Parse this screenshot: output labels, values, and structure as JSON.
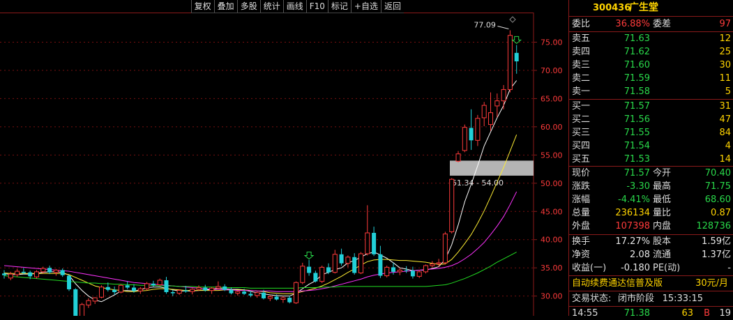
{
  "toolbar": [
    "复权",
    "叠加",
    "多股",
    "统计",
    "画线",
    "F10",
    "标记",
    "+自选",
    "返回"
  ],
  "stock": {
    "code": "300436",
    "name": "广生堂"
  },
  "chart": {
    "y_ticks": [
      "75.00",
      "70.00",
      "65.00",
      "60.00",
      "55.00",
      "50.00",
      "45.00",
      "40.00",
      "35.00",
      "30.00"
    ],
    "high_label": "77.09",
    "zone_label": "51.34 - 54.00",
    "zone_low": 51.34,
    "zone_high": 54.0,
    "ymin": 26.5,
    "ymax": 80.0,
    "candles": [
      [
        34.0,
        34.6,
        33.1,
        33.7
      ],
      [
        33.2,
        34.3,
        32.8,
        33.9
      ],
      [
        33.8,
        34.8,
        33.4,
        34.4
      ],
      [
        34.3,
        35.0,
        33.9,
        34.1
      ],
      [
        34.2,
        34.5,
        33.0,
        33.5
      ],
      [
        33.4,
        34.6,
        33.1,
        34.3
      ],
      [
        34.3,
        35.2,
        34.0,
        34.9
      ],
      [
        35.0,
        35.4,
        33.9,
        34.2
      ],
      [
        34.2,
        34.8,
        33.6,
        34.6
      ],
      [
        34.6,
        34.9,
        33.4,
        33.7
      ],
      [
        33.6,
        33.8,
        30.9,
        31.2
      ],
      [
        31.2,
        31.4,
        25.5,
        26.3
      ],
      [
        26.3,
        28.8,
        26.1,
        28.5
      ],
      [
        28.4,
        29.6,
        27.9,
        29.2
      ],
      [
        29.1,
        29.8,
        28.6,
        29.7
      ],
      [
        29.8,
        31.9,
        29.6,
        31.6
      ],
      [
        31.6,
        32.4,
        30.8,
        31.1
      ],
      [
        31.1,
        31.7,
        30.2,
        30.7
      ],
      [
        30.7,
        32.1,
        30.5,
        31.9
      ],
      [
        31.9,
        32.6,
        31.2,
        31.5
      ],
      [
        31.5,
        32.1,
        30.6,
        30.9
      ],
      [
        30.9,
        31.6,
        30.4,
        31.3
      ],
      [
        31.3,
        32.5,
        31.0,
        32.2
      ],
      [
        32.2,
        32.7,
        31.6,
        31.9
      ],
      [
        32.0,
        33.1,
        31.8,
        32.8
      ],
      [
        32.8,
        33.4,
        30.4,
        30.7
      ],
      [
        30.7,
        31.1,
        30.0,
        30.5
      ],
      [
        30.5,
        31.2,
        30.2,
        31.0
      ],
      [
        31.0,
        31.8,
        30.6,
        30.8
      ],
      [
        30.8,
        31.4,
        30.3,
        31.2
      ],
      [
        31.2,
        31.9,
        30.9,
        31.5
      ],
      [
        31.5,
        32.0,
        30.8,
        31.0
      ],
      [
        31.0,
        31.6,
        30.4,
        31.4
      ],
      [
        31.4,
        32.6,
        31.2,
        31.7
      ],
      [
        31.7,
        32.1,
        30.9,
        31.1
      ],
      [
        31.1,
        31.5,
        30.3,
        30.5
      ],
      [
        30.5,
        31.0,
        30.1,
        30.8
      ],
      [
        30.8,
        31.3,
        30.2,
        30.4
      ],
      [
        30.4,
        30.9,
        29.8,
        30.1
      ],
      [
        30.1,
        30.8,
        29.7,
        30.6
      ],
      [
        30.6,
        31.1,
        29.4,
        29.6
      ],
      [
        29.6,
        30.2,
        29.1,
        29.9
      ],
      [
        29.9,
        30.3,
        29.2,
        29.4
      ],
      [
        29.4,
        30.0,
        28.8,
        29.7
      ],
      [
        29.7,
        30.1,
        28.7,
        28.9
      ],
      [
        28.8,
        32.6,
        28.6,
        32.4
      ],
      [
        32.4,
        35.9,
        32.1,
        35.3
      ],
      [
        35.2,
        36.4,
        33.6,
        34.1
      ],
      [
        34.1,
        34.5,
        32.4,
        32.6
      ],
      [
        32.6,
        35.4,
        32.3,
        35.1
      ],
      [
        35.1,
        35.8,
        33.9,
        34.2
      ],
      [
        34.2,
        38.2,
        34.0,
        37.4
      ],
      [
        37.4,
        38.4,
        35.4,
        35.8
      ],
      [
        35.8,
        37.2,
        35.1,
        36.9
      ],
      [
        36.9,
        37.6,
        33.8,
        34.1
      ],
      [
        34.1,
        37.8,
        33.9,
        37.5
      ],
      [
        37.5,
        46.1,
        37.2,
        41.2
      ],
      [
        41.2,
        42.3,
        37.1,
        37.4
      ],
      [
        37.4,
        38.9,
        33.2,
        33.6
      ],
      [
        33.6,
        35.4,
        33.3,
        35.1
      ],
      [
        35.1,
        35.9,
        33.8,
        34.3
      ],
      [
        34.3,
        35.0,
        33.7,
        34.6
      ],
      [
        34.6,
        35.3,
        34.1,
        34.5
      ],
      [
        34.5,
        35.2,
        33.1,
        33.5
      ],
      [
        33.5,
        34.6,
        33.2,
        34.3
      ],
      [
        34.3,
        35.6,
        34.0,
        35.4
      ],
      [
        35.4,
        36.2,
        35.1,
        35.7
      ],
      [
        35.7,
        36.6,
        35.2,
        35.9
      ],
      [
        35.9,
        41.4,
        35.6,
        41.0
      ],
      [
        41.4,
        50.9,
        41.1,
        50.7
      ],
      [
        53.9,
        55.7,
        53.7,
        55.2
      ],
      [
        55.8,
        60.4,
        55.5,
        59.9
      ],
      [
        59.8,
        63.1,
        55.9,
        57.6
      ],
      [
        57.6,
        62.1,
        56.6,
        61.5
      ],
      [
        61.6,
        64.4,
        60.1,
        63.8
      ],
      [
        60.4,
        66.1,
        59.3,
        62.5
      ],
      [
        63.7,
        65.9,
        61.7,
        64.6
      ],
      [
        64.6,
        67.4,
        63.1,
        66.6
      ],
      [
        66.6,
        77.1,
        66.1,
        76.2
      ],
      [
        73.1,
        74.5,
        69.4,
        71.6
      ]
    ],
    "ma": [
      {
        "color": "#ffffff",
        "values": [
          34.0,
          33.8,
          33.8,
          33.9,
          33.9,
          34.0,
          34.2,
          34.3,
          34.3,
          34.2,
          33.7,
          32.2,
          31.0,
          30.0,
          29.3,
          29.0,
          29.6,
          30.2,
          30.9,
          31.0,
          30.9,
          31.1,
          31.5,
          31.6,
          31.6,
          31.4,
          31.1,
          30.9,
          30.9,
          30.9,
          31.0,
          31.1,
          31.2,
          31.4,
          31.3,
          31.2,
          31.2,
          31.1,
          30.8,
          30.6,
          30.4,
          30.2,
          30.1,
          30.0,
          30.0,
          30.5,
          31.3,
          32.1,
          32.7,
          33.8,
          34.2,
          34.7,
          35.0,
          35.9,
          36.3,
          36.9,
          37.5,
          37.8,
          37.3,
          36.7,
          35.9,
          35.0,
          34.8,
          34.5,
          34.6,
          34.6,
          34.9,
          35.2,
          36.5,
          39.1,
          42.6,
          46.7,
          49.8,
          53.1,
          56.6,
          59.1,
          61.6,
          63.8,
          66.7,
          68.2
        ]
      },
      {
        "color": "#ffee33",
        "values": [
          34.1,
          34.0,
          34.0,
          34.0,
          34.0,
          34.0,
          34.0,
          34.0,
          34.0,
          34.0,
          33.8,
          33.3,
          32.8,
          32.3,
          31.8,
          31.5,
          31.3,
          31.1,
          31.0,
          30.8,
          30.8,
          30.9,
          31.0,
          31.2,
          31.3,
          31.3,
          31.2,
          31.1,
          31.0,
          31.0,
          31.0,
          31.0,
          31.0,
          31.0,
          31.1,
          31.1,
          31.1,
          31.1,
          31.0,
          30.9,
          30.8,
          30.6,
          30.5,
          30.4,
          30.4,
          30.5,
          30.8,
          31.1,
          31.4,
          31.8,
          32.3,
          32.9,
          33.5,
          34.2,
          34.8,
          35.5,
          36.1,
          36.4,
          36.5,
          36.5,
          36.4,
          36.3,
          36.3,
          36.2,
          36.1,
          36.0,
          35.8,
          35.6,
          35.7,
          36.5,
          37.8,
          39.3,
          40.9,
          42.9,
          45.1,
          47.6,
          50.2,
          52.8,
          55.7,
          58.6
        ]
      },
      {
        "color": "#ff33ff",
        "values": [
          35.4,
          35.3,
          35.2,
          35.1,
          35.0,
          34.9,
          34.8,
          34.7,
          34.6,
          34.5,
          34.4,
          34.2,
          34.0,
          33.8,
          33.6,
          33.4,
          33.2,
          33.0,
          32.8,
          32.6,
          32.4,
          32.3,
          32.2,
          32.1,
          32.0,
          31.9,
          31.8,
          31.7,
          31.6,
          31.5,
          31.4,
          31.3,
          31.2,
          31.2,
          31.1,
          31.1,
          31.0,
          31.0,
          31.0,
          30.9,
          30.9,
          30.9,
          30.8,
          30.8,
          30.8,
          30.8,
          30.9,
          31.0,
          31.1,
          31.3,
          31.5,
          31.8,
          32.1,
          32.4,
          32.7,
          33.0,
          33.4,
          33.7,
          33.9,
          34.1,
          34.2,
          34.3,
          34.4,
          34.5,
          34.6,
          34.7,
          34.8,
          34.9,
          35.1,
          35.4,
          35.9,
          36.6,
          37.4,
          38.4,
          39.5,
          40.9,
          42.4,
          44.1,
          46.2,
          48.5
        ]
      },
      {
        "color": "#22dd22",
        "values": [
          33.6,
          33.5,
          33.4,
          33.3,
          33.2,
          33.1,
          33.0,
          32.9,
          32.8,
          32.7,
          32.6,
          32.5,
          32.4,
          32.3,
          32.3,
          32.2,
          32.2,
          32.1,
          32.1,
          32.0,
          32.0,
          31.9,
          31.9,
          31.9,
          31.8,
          31.8,
          31.8,
          31.7,
          31.7,
          31.7,
          31.6,
          31.6,
          31.6,
          31.6,
          31.5,
          31.5,
          31.5,
          31.5,
          31.4,
          31.4,
          31.4,
          31.4,
          31.4,
          31.4,
          31.4,
          31.4,
          31.5,
          31.5,
          31.5,
          31.6,
          31.6,
          31.6,
          31.7,
          31.7,
          31.7,
          31.7,
          31.7,
          31.7,
          31.7,
          31.7,
          31.7,
          31.7,
          31.7,
          31.7,
          31.7,
          31.7,
          31.8,
          31.9,
          32.0,
          32.3,
          32.7,
          33.1,
          33.6,
          34.1,
          34.7,
          35.3,
          36.0,
          36.6,
          37.2,
          37.8
        ]
      }
    ]
  },
  "quote": {
    "weibi_label": "委比",
    "weibi": "36.88%",
    "weicha_label": "委差",
    "weicha": "97",
    "asks": [
      {
        "label": "卖五",
        "price": "71.63",
        "vol": "12"
      },
      {
        "label": "卖四",
        "price": "71.62",
        "vol": "25"
      },
      {
        "label": "卖三",
        "price": "71.60",
        "vol": "30"
      },
      {
        "label": "卖二",
        "price": "71.59",
        "vol": "11"
      },
      {
        "label": "卖一",
        "price": "71.58",
        "vol": "5"
      }
    ],
    "bids": [
      {
        "label": "买一",
        "price": "71.57",
        "vol": "31"
      },
      {
        "label": "买二",
        "price": "71.56",
        "vol": "47"
      },
      {
        "label": "买三",
        "price": "71.55",
        "vol": "84"
      },
      {
        "label": "买四",
        "price": "71.54",
        "vol": "4"
      },
      {
        "label": "买五",
        "price": "71.53",
        "vol": "14"
      }
    ],
    "stats": [
      {
        "l1": "现价",
        "v1": "71.57",
        "c1": "green",
        "l2": "今开",
        "v2": "70.40",
        "c2": "green"
      },
      {
        "l1": "涨跌",
        "v1": "-3.30",
        "c1": "green",
        "l2": "最高",
        "v2": "71.75",
        "c2": "green"
      },
      {
        "l1": "涨幅",
        "v1": "-4.41%",
        "c1": "green",
        "l2": "最低",
        "v2": "68.60",
        "c2": "green"
      },
      {
        "l1": "总量",
        "v1": "236134",
        "c1": "yellow",
        "l2": "量比",
        "v2": "0.87",
        "c2": "yellow"
      },
      {
        "l1": "外盘",
        "v1": "107398",
        "c1": "red",
        "l2": "内盘",
        "v2": "128736",
        "c2": "green"
      }
    ],
    "fin": [
      {
        "l1": "换手",
        "v1": "17.27%",
        "l2": "股本",
        "v2": "1.59亿"
      },
      {
        "l1": "净资",
        "v1": "2.08",
        "l2": "流通",
        "v2": "1.37亿"
      },
      {
        "l1": "收益(一)",
        "v1": "-0.180",
        "l2": "PE(动)",
        "v2": "-"
      }
    ],
    "promo": "自动续费通达信普及版",
    "promo_price": "30元/月",
    "status_label": "交易状态:",
    "status": "闭市阶段",
    "time": "15:33:15",
    "tick": {
      "time": "14:55",
      "price": "71.38",
      "vol": "63",
      "side": "B",
      "count": "19"
    }
  }
}
